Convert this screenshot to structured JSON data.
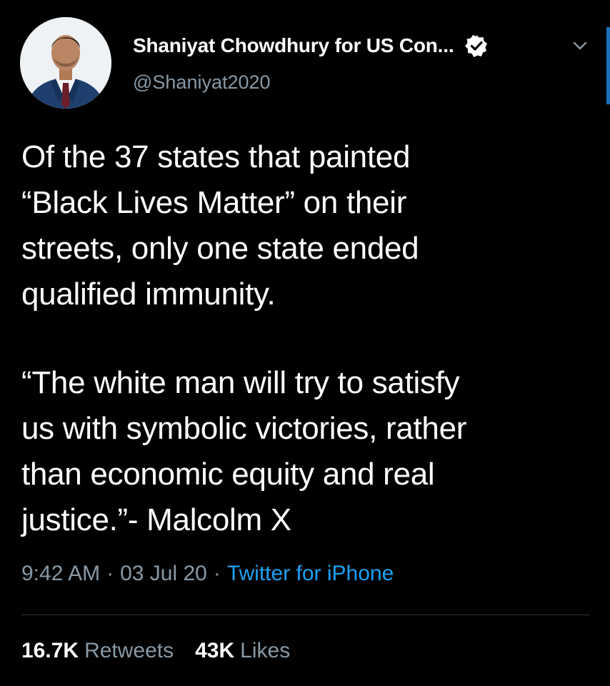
{
  "header": {
    "display_name": "Shaniyat Chowdhury for US Con...",
    "handle": "@Shaniyat2020",
    "avatar_icon": "user-avatar-photo",
    "verified_icon": "verified-badge-icon",
    "menu_icon": "chevron-down-icon"
  },
  "tweet": {
    "paragraph_1": "Of the 37 states that painted\n“Black Lives Matter” on their\nstreets, only one state ended\nqualified immunity.",
    "paragraph_2": "“The white man will try to satisfy\nus with symbolic victories, rather\nthan economic equity and real\njustice.”- Malcolm X"
  },
  "meta": {
    "time": "9:42 AM",
    "separator": "·",
    "date": "03 Jul 20",
    "source": "Twitter for iPhone"
  },
  "stats": {
    "retweets_count": "16.7K",
    "retweets_label": "Retweets",
    "likes_count": "43K",
    "likes_label": "Likes"
  },
  "colors": {
    "background": "#000000",
    "text_primary": "#ffffff",
    "text_secondary": "#8899a6",
    "link": "#1da1f2",
    "divider": "#2f3336"
  }
}
